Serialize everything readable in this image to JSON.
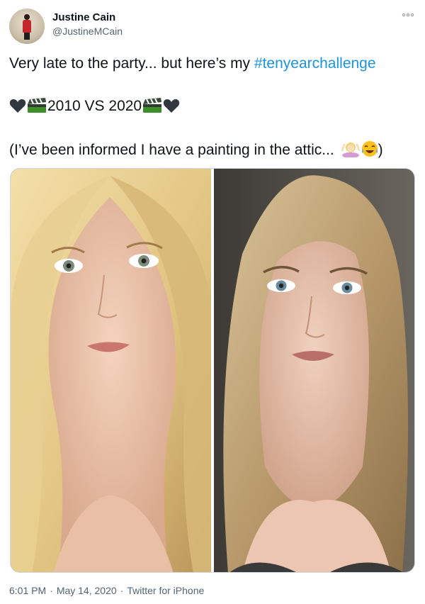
{
  "author": {
    "name": "Justine Cain",
    "handle": "@JustineMCain"
  },
  "tweet": {
    "line1_prefix": "Very late to the party... but here’s my ",
    "hashtag": "#tenyearchallenge",
    "line2_text": "2010 VS 2020",
    "line3_text": "(I’ve been informed I have a painting in the attic... ",
    "line3_suffix": ")",
    "emojis": [
      "black-heart-icon",
      "clapper-board-icon",
      "clapper-board-icon",
      "black-heart-icon",
      "woman-shrugging-icon",
      "face-with-tears-of-joy-icon"
    ]
  },
  "media": {
    "photos": [
      "portrait-2010",
      "portrait-2020"
    ]
  },
  "meta": {
    "time": "6:01 PM",
    "separator": "·",
    "date": "May 14, 2020",
    "source": "Twitter for iPhone"
  },
  "colors": {
    "hashtag": "#1b95e0",
    "secondary_text": "#536471",
    "primary_text": "#0f1419"
  }
}
